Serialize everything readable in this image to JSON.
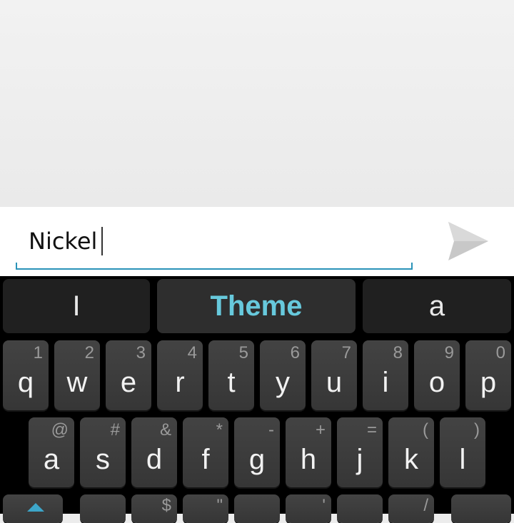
{
  "compose": {
    "text": "Nickel",
    "send_icon": "send-icon"
  },
  "keyboard": {
    "suggestions": [
      "I",
      "Theme",
      "a"
    ],
    "row1": [
      {
        "label": "q",
        "hint": "1"
      },
      {
        "label": "w",
        "hint": "2"
      },
      {
        "label": "e",
        "hint": "3"
      },
      {
        "label": "r",
        "hint": "4"
      },
      {
        "label": "t",
        "hint": "5"
      },
      {
        "label": "y",
        "hint": "6"
      },
      {
        "label": "u",
        "hint": "7"
      },
      {
        "label": "i",
        "hint": "8"
      },
      {
        "label": "o",
        "hint": "9"
      },
      {
        "label": "p",
        "hint": "0"
      }
    ],
    "row2": [
      {
        "label": "a",
        "hint": "@"
      },
      {
        "label": "s",
        "hint": "#"
      },
      {
        "label": "d",
        "hint": "&"
      },
      {
        "label": "f",
        "hint": "*"
      },
      {
        "label": "g",
        "hint": "-"
      },
      {
        "label": "h",
        "hint": "+"
      },
      {
        "label": "j",
        "hint": "="
      },
      {
        "label": "k",
        "hint": "("
      },
      {
        "label": "l",
        "hint": ")"
      }
    ],
    "row3_hints": [
      "$",
      "\"",
      "'",
      "/"
    ],
    "shift_icon": "shift-icon",
    "colors": {
      "accent": "#67c9dc",
      "underline": "#2a93b8",
      "key": "#3c3c3c",
      "background": "#000000"
    }
  }
}
